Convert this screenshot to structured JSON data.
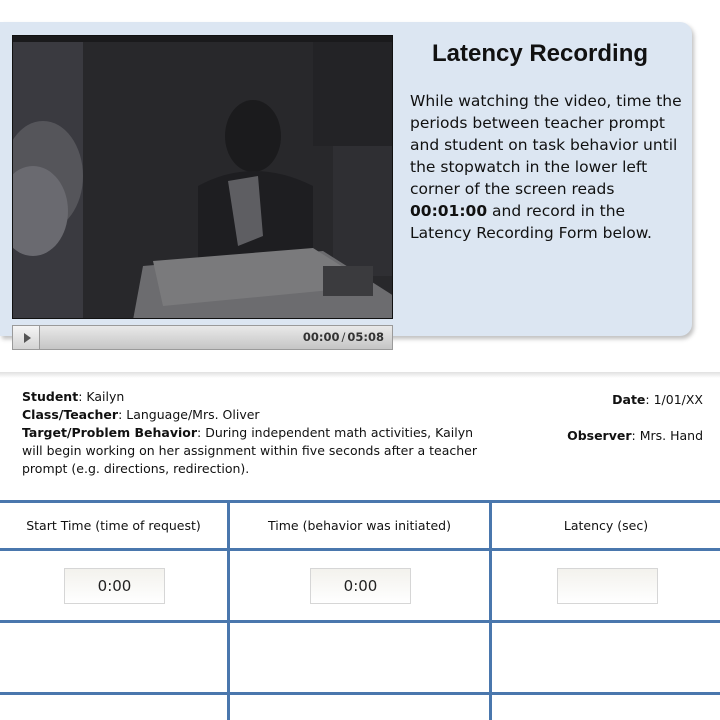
{
  "panel": {
    "title": "Latency Recording",
    "body_part1": "While watching the video, time the periods between teacher prompt and student on task behavior until the stopwatch in the lower left corner of the screen reads ",
    "body_bold": "00:01:00",
    "body_part2": " and record in the Latency Recording Form below."
  },
  "player": {
    "current_time": "00:00",
    "duration": "05:08",
    "progress": 0
  },
  "info": {
    "student_label": "Student",
    "student_value": ": Kailyn",
    "class_label": "Class/Teacher",
    "class_value": ": Language/Mrs. Oliver",
    "target_label": "Target/Problem Behavior",
    "target_value": ": During independent math activities, Kailyn will begin working on her assignment within five seconds after a teacher prompt (e.g. directions, redirection).",
    "date_label": "Date",
    "date_value": ": 1/01/XX",
    "observer_label": "Observer",
    "observer_value": ": Mrs. Hand"
  },
  "table": {
    "columns": [
      "Start Time (time of request)",
      "Time (behavior was initiated)",
      "Latency (sec)"
    ],
    "rows": [
      [
        "0:00",
        "0:00",
        ""
      ]
    ]
  },
  "colors": {
    "panel_bg": "#dce6f2",
    "grid_lines": "#4a77ad"
  }
}
